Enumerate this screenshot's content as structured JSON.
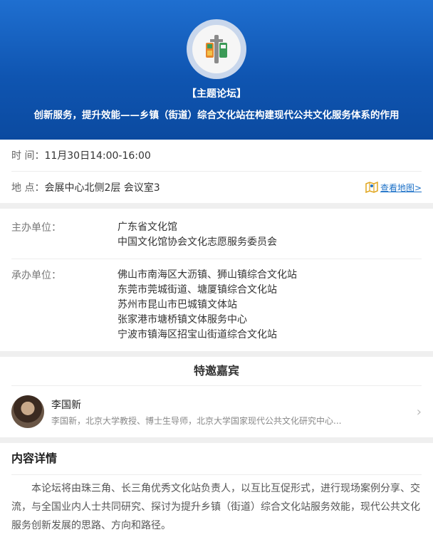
{
  "hero": {
    "tag": "【主题论坛】",
    "title": "创新服务，提升效能——乡镇（街道）综合文化站在构建现代公共文化服务体系的作用",
    "logo_icon": "forum-logo-icon"
  },
  "info": {
    "time_label": "时 间：",
    "time_value": "11月30日14:00-16:00",
    "place_label": "地 点：",
    "place_value": "会展中心北侧2层 会议室3",
    "map_label": "查看地图>",
    "map_icon": "map-icon"
  },
  "organizers": {
    "host_label": "主办单位：",
    "hosts": [
      "广东省文化馆",
      "中国文化馆协会文化志愿服务委员会"
    ],
    "co_label": "承办单位：",
    "co_hosts": [
      "佛山市南海区大沥镇、狮山镇综合文化站",
      "东莞市莞城街道、塘厦镇综合文化站",
      "苏州市昆山市巴城镇文体站",
      "张家港市塘桥镇文体服务中心",
      "宁波市镇海区招宝山街道综合文化站"
    ]
  },
  "guests": {
    "heading": "特邀嘉宾",
    "items": [
      {
        "name": "李国新",
        "desc": "李国新，北京大学教授、博士生导师，北京大学国家现代公共文化研究中心..."
      }
    ]
  },
  "detail": {
    "heading": "内容详情",
    "body": "本论坛将由珠三角、长三角优秀文化站负责人，以互比互促形式，进行现场案例分享、交流，与全国业内人士共同研究、探讨为提升乡镇（街道）综合文化站服务效能，现代公共文化服务创新发展的思路、方向和路径。"
  },
  "colors": {
    "hero_blue": "#1a63c2",
    "link_blue": "#1e72c8",
    "logo_green": "#3c9a57",
    "logo_orange": "#e6872c",
    "logo_gray": "#8a8a8a"
  }
}
